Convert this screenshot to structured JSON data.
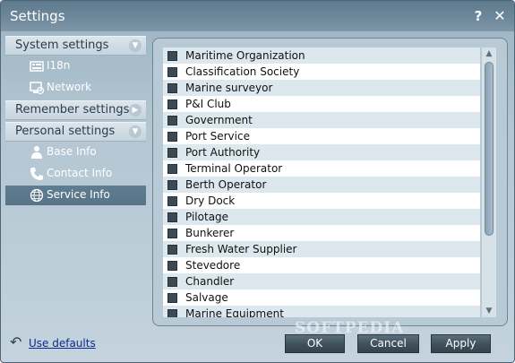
{
  "window": {
    "title": "Settings"
  },
  "titlebar": {
    "help": "?",
    "close": "✕"
  },
  "sidebar": {
    "groups": [
      {
        "label": "System settings",
        "expanded": true
      },
      {
        "label": "Remember settings",
        "expanded": false
      },
      {
        "label": "Personal settings",
        "expanded": true
      }
    ],
    "items": [
      {
        "label": "I18n",
        "icon": "i18n-icon"
      },
      {
        "label": "Network",
        "icon": "network-icon"
      },
      {
        "label": "Base Info",
        "icon": "base-info-icon"
      },
      {
        "label": "Contact Info",
        "icon": "phone-icon"
      },
      {
        "label": "Service Info",
        "icon": "globe-icon",
        "selected": true
      }
    ]
  },
  "services": [
    "Maritime Organization",
    "Classification Society",
    "Marine surveyor",
    "P&I Club",
    "Government",
    "Port Service",
    "Port Authority",
    "Terminal Operator",
    "Berth Operator",
    "Dry Dock",
    "Pilotage",
    "Bunkerer",
    "Fresh Water Supplier",
    "Stevedore",
    "Chandler",
    "Salvage",
    "Marine Equipment"
  ],
  "footer": {
    "use_defaults": "Use defaults",
    "ok": "OK",
    "cancel": "Cancel",
    "apply": "Apply",
    "watermark": "SOFTPEDIA"
  },
  "colors": {
    "titlebar": "#6d889a",
    "selected_item": "#5f7d90",
    "link": "#0b2c8f"
  }
}
